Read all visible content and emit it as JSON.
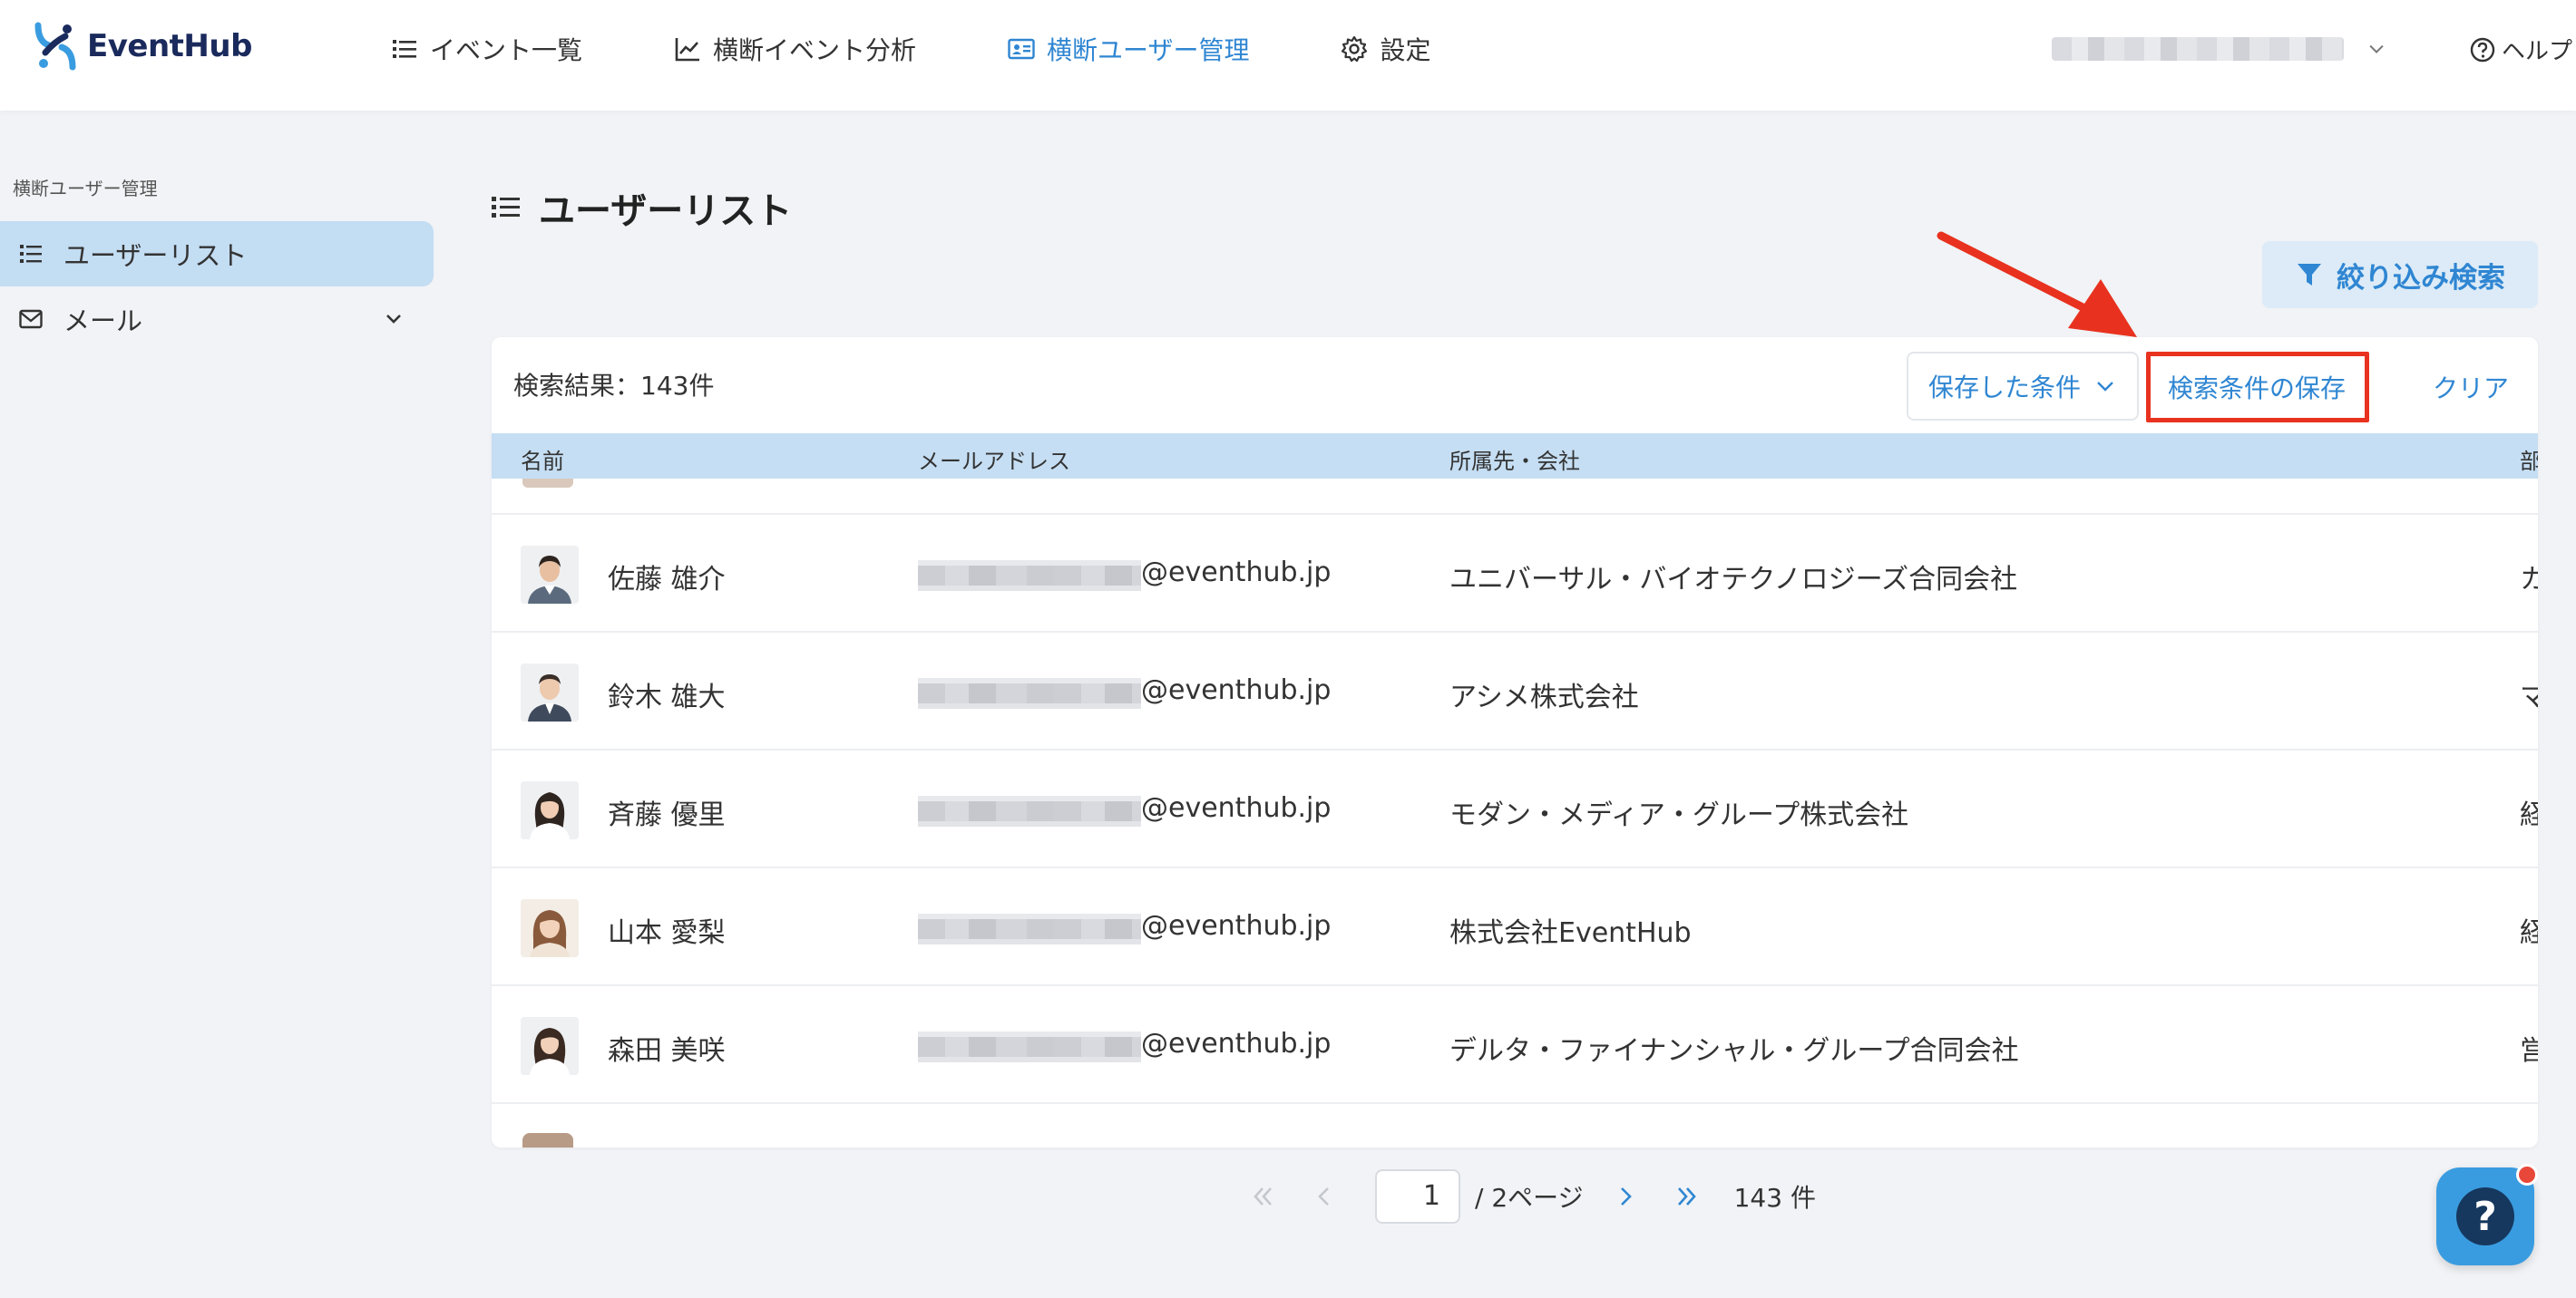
{
  "app": {
    "brand": "EventHub"
  },
  "nav": {
    "items": [
      {
        "label": "イベント一覧",
        "icon": "list-icon",
        "active": false
      },
      {
        "label": "横断イベント分析",
        "icon": "chart-line-icon",
        "active": false
      },
      {
        "label": "横断ユーザー管理",
        "icon": "id-card-icon",
        "active": true
      },
      {
        "label": "設定",
        "icon": "gear-icon",
        "active": false
      }
    ],
    "help": "ヘルプ"
  },
  "sidebar": {
    "heading": "横断ユーザー管理",
    "items": [
      {
        "label": "ユーザーリスト",
        "icon": "list-icon",
        "active": true
      },
      {
        "label": "メール",
        "icon": "mail-icon",
        "expandable": true
      }
    ]
  },
  "page": {
    "title": "ユーザーリスト",
    "filter_button": "絞り込み検索"
  },
  "results": {
    "count_label": "検索結果：143件",
    "saved_conditions": "保存した条件",
    "save_conditions": "検索条件の保存",
    "clear": "クリア"
  },
  "table": {
    "headers": [
      "名前",
      "メールアドレス",
      "所属先・会社",
      "部"
    ],
    "rows": [
      {
        "name": "佐藤 雄介",
        "email_domain": "@eventhub.jp",
        "company": "ユニバーサル・バイオテクノロジーズ合同会社",
        "dept": "カ",
        "avatar": "male-1"
      },
      {
        "name": "鈴木 雄大",
        "email_domain": "@eventhub.jp",
        "company": "アシメ株式会社",
        "dept": "マ",
        "avatar": "male-2"
      },
      {
        "name": "斉藤 優里",
        "email_domain": "@eventhub.jp",
        "company": "モダン・メディア・グループ株式会社",
        "dept": "経",
        "avatar": "female-1"
      },
      {
        "name": "山本 愛梨",
        "email_domain": "@eventhub.jp",
        "company": "株式会社EventHub",
        "dept": "経",
        "avatar": "female-2"
      },
      {
        "name": "森田 美咲",
        "email_domain": "@eventhub.jp",
        "company": "デルタ・ファイナンシャル・グループ合同会社",
        "dept": "営",
        "avatar": "female-3"
      }
    ]
  },
  "pagination": {
    "current_page": "1",
    "total_label": "/ 2ページ",
    "count_label": "143 件"
  },
  "colors": {
    "accent": "#2f86d2",
    "highlight": "#e8321f",
    "header_row": "#c5def3"
  }
}
